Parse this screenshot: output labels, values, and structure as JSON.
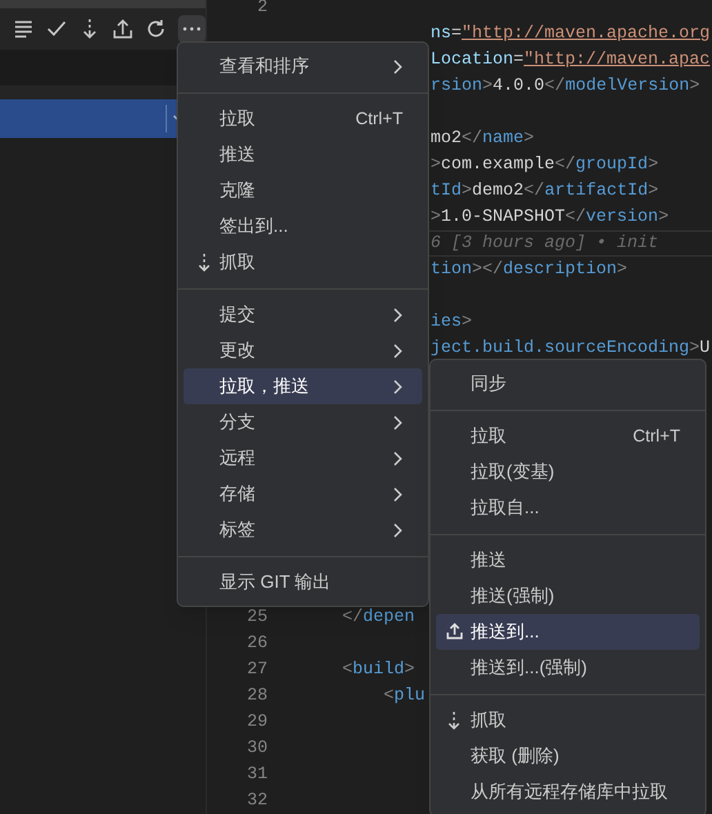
{
  "editor": {
    "lines_top": [
      {
        "number": "2",
        "kind": "full",
        "current": false
      },
      {
        "kind": "partial",
        "current": false,
        "segments": [
          {
            "kind": "attr",
            "text": "ns"
          },
          {
            "kind": "op",
            "text": "="
          },
          {
            "kind": "string",
            "text": "\"http://maven.apache.org"
          }
        ]
      },
      {
        "kind": "partial",
        "current": false,
        "segments": [
          {
            "kind": "attr",
            "text": "Location"
          },
          {
            "kind": "op",
            "text": "="
          },
          {
            "kind": "string",
            "text": "\"http://maven.apac"
          }
        ]
      },
      {
        "kind": "partial",
        "current": false,
        "segments": [
          {
            "kind": "tag",
            "text": "rsion"
          },
          {
            "kind": "punct",
            "text": ">"
          },
          {
            "kind": "text",
            "text": "4.0.0"
          },
          {
            "kind": "punct",
            "text": "</"
          },
          {
            "kind": "tag",
            "text": "modelVersion"
          },
          {
            "kind": "punct",
            "text": ">"
          }
        ]
      },
      {
        "kind": "partial",
        "current": false
      },
      {
        "kind": "partial",
        "current": false,
        "segments": [
          {
            "kind": "text",
            "text": "mo2"
          },
          {
            "kind": "punct",
            "text": "</"
          },
          {
            "kind": "tag",
            "text": "name"
          },
          {
            "kind": "punct",
            "text": ">"
          }
        ]
      },
      {
        "kind": "partial",
        "current": false,
        "segments": [
          {
            "kind": "punct",
            "text": ">"
          },
          {
            "kind": "text",
            "text": "com.example"
          },
          {
            "kind": "punct",
            "text": "</"
          },
          {
            "kind": "tag",
            "text": "groupId"
          },
          {
            "kind": "punct",
            "text": ">"
          }
        ]
      },
      {
        "kind": "partial",
        "current": false,
        "segments": [
          {
            "kind": "tag",
            "text": "tId"
          },
          {
            "kind": "punct",
            "text": ">"
          },
          {
            "kind": "text",
            "text": "demo2"
          },
          {
            "kind": "punct",
            "text": "</"
          },
          {
            "kind": "tag",
            "text": "artifactId"
          },
          {
            "kind": "punct",
            "text": ">"
          }
        ]
      },
      {
        "kind": "partial",
        "current": false,
        "segments": [
          {
            "kind": "punct",
            "text": ">"
          },
          {
            "kind": "text",
            "text": "1.0-SNAPSHOT"
          },
          {
            "kind": "punct",
            "text": "</"
          },
          {
            "kind": "tag",
            "text": "version"
          },
          {
            "kind": "punct",
            "text": ">"
          }
        ]
      },
      {
        "kind": "partial",
        "current": true,
        "segments": [
          {
            "kind": "blame",
            "text": "6 [3 hours ago] • init"
          }
        ]
      },
      {
        "kind": "partial",
        "current": false,
        "segments": [
          {
            "kind": "tag",
            "text": "tion"
          },
          {
            "kind": "punct",
            "text": "></"
          },
          {
            "kind": "tag",
            "text": "description"
          },
          {
            "kind": "punct",
            "text": ">"
          }
        ]
      },
      {
        "kind": "partial",
        "current": false
      },
      {
        "kind": "partial",
        "current": false,
        "segments": [
          {
            "kind": "tag",
            "text": "ies"
          },
          {
            "kind": "punct",
            "text": ">"
          }
        ]
      },
      {
        "kind": "partial",
        "current": false,
        "segments": [
          {
            "kind": "tag",
            "text": "ject.build.sourceEncoding"
          },
          {
            "kind": "punct",
            "text": ">"
          },
          {
            "kind": "text",
            "text": "U"
          }
        ]
      }
    ],
    "lines_bottom": [
      {
        "number": "25",
        "kind": "full",
        "current": false,
        "segments": [
          {
            "kind": "punct",
            "text": "    </"
          },
          {
            "kind": "tag",
            "text": "depen"
          }
        ]
      },
      {
        "number": "26",
        "kind": "full",
        "current": false
      },
      {
        "number": "27",
        "kind": "full",
        "current": false,
        "segments": [
          {
            "kind": "punct",
            "text": "    <"
          },
          {
            "kind": "tag",
            "text": "build"
          },
          {
            "kind": "punct",
            "text": ">"
          }
        ]
      },
      {
        "number": "28",
        "kind": "full",
        "current": false,
        "segments": [
          {
            "kind": "punct",
            "text": "        <"
          },
          {
            "kind": "tag",
            "text": "plu"
          }
        ]
      },
      {
        "number": "29",
        "kind": "full",
        "current": false
      },
      {
        "number": "30",
        "kind": "full",
        "current": false
      },
      {
        "number": "31",
        "kind": "full",
        "current": false
      },
      {
        "number": "32",
        "kind": "full",
        "current": false
      }
    ]
  },
  "context_menu": {
    "items": [
      {
        "kind": "item",
        "label": "查看和排序",
        "arrow": true,
        "selected": false
      },
      {
        "kind": "separator"
      },
      {
        "kind": "item",
        "label": "拉取",
        "shortcut": "Ctrl+T",
        "arrow": false,
        "selected": false
      },
      {
        "kind": "item",
        "label": "推送",
        "arrow": false,
        "selected": false
      },
      {
        "kind": "item",
        "label": "克隆",
        "arrow": false,
        "selected": false
      },
      {
        "kind": "item",
        "label": "签出到...",
        "arrow": false,
        "selected": false
      },
      {
        "kind": "fetch-item",
        "label": "抓取",
        "arrow": false,
        "selected": false
      },
      {
        "kind": "separator"
      },
      {
        "kind": "item",
        "label": "提交",
        "arrow": true,
        "selected": false
      },
      {
        "kind": "item",
        "label": "更改",
        "arrow": true,
        "selected": false
      },
      {
        "kind": "item",
        "label": "拉取，推送",
        "arrow": true,
        "selected": true
      },
      {
        "kind": "item",
        "label": "分支",
        "arrow": true,
        "selected": false
      },
      {
        "kind": "item",
        "label": "远程",
        "arrow": true,
        "selected": false
      },
      {
        "kind": "item",
        "label": "存储",
        "arrow": true,
        "selected": false
      },
      {
        "kind": "item",
        "label": "标签",
        "arrow": true,
        "selected": false
      },
      {
        "kind": "separator"
      },
      {
        "kind": "item",
        "label": "显示 GIT 输出",
        "arrow": false,
        "selected": false
      }
    ]
  },
  "submenu": {
    "items": [
      {
        "kind": "item",
        "label": "同步",
        "selected": false
      },
      {
        "kind": "separator"
      },
      {
        "kind": "item",
        "label": "拉取",
        "shortcut": "Ctrl+T",
        "selected": false
      },
      {
        "kind": "item",
        "label": "拉取(变基)",
        "selected": false
      },
      {
        "kind": "item",
        "label": "拉取自...",
        "selected": false
      },
      {
        "kind": "separator"
      },
      {
        "kind": "item",
        "label": "推送",
        "selected": false
      },
      {
        "kind": "item",
        "label": "推送(强制)",
        "selected": false
      },
      {
        "kind": "upload-item",
        "label": "推送到...",
        "selected": true
      },
      {
        "kind": "item",
        "label": "推送到...(强制)",
        "selected": false
      },
      {
        "kind": "separator"
      },
      {
        "kind": "fetch-item",
        "label": "抓取",
        "selected": false
      },
      {
        "kind": "item",
        "label": "获取 (删除)",
        "selected": false
      },
      {
        "kind": "item",
        "label": "从所有远程存储库中拉取",
        "selected": false
      }
    ]
  }
}
